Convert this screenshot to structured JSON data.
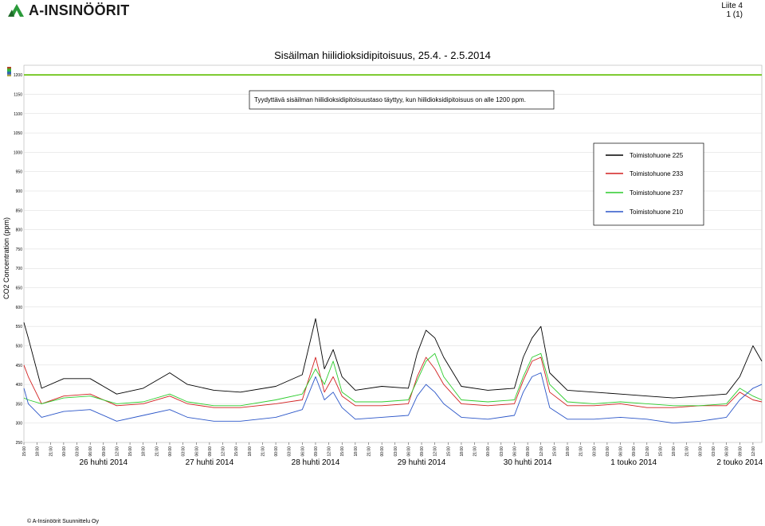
{
  "header": {
    "logo_text": "A-INSINÖÖRIT",
    "page_label": "Liite 4",
    "page_count": "1 (1)"
  },
  "footer": {
    "copyright": "© A-Insinöörit Suunnittelu Oy"
  },
  "colors": {
    "s225": "#000000",
    "s233": "#d22020",
    "s237": "#2ccc2c",
    "s210": "#2a55c8",
    "limit": "#78c828"
  },
  "chart_data": {
    "type": "line",
    "title": "Sisäilman hiilidioksidipitoisuus, 25.4. - 2.5.2014",
    "ylabel": "CO2 Concentration (ppm)",
    "xlabel": "",
    "ylim": [
      250,
      1225
    ],
    "yticks": [
      250,
      300,
      350,
      400,
      450,
      500,
      550,
      600,
      650,
      700,
      750,
      800,
      850,
      900,
      950,
      1000,
      1050,
      1100,
      1150,
      1200
    ],
    "grid": true,
    "legend_position": "right",
    "limit_line": 1200,
    "annotation": "Tyydyttävä sisäilman hiilidioksidipitoisuustaso täyttyy, kun hiilidioksidipitoisuus on alle 1200 ppm.",
    "x_start": "2014-04-25 15:00",
    "x_end": "2014-05-02 14:00",
    "hour_labels": [
      "15:00",
      "18:00",
      "21:00",
      "00:00",
      "03:00",
      "06:00",
      "09:00",
      "12:00"
    ],
    "day_labels": [
      "26 huhti 2014",
      "27 huhti 2014",
      "28 huhti 2014",
      "29 huhti 2014",
      "30 huhti 2014",
      "1 touko 2014",
      "2 touko 2014"
    ],
    "series": [
      {
        "name": "Toimistohuone 225",
        "color": "#000000",
        "x": [
          "2014-04-25 15:00",
          "2014-04-25 16:00",
          "2014-04-25 19:00",
          "2014-04-26 00:00",
          "2014-04-26 06:00",
          "2014-04-26 12:00",
          "2014-04-26 18:00",
          "2014-04-27 00:00",
          "2014-04-27 04:00",
          "2014-04-27 10:00",
          "2014-04-27 16:00",
          "2014-04-28 00:00",
          "2014-04-28 06:00",
          "2014-04-28 09:00",
          "2014-04-28 11:00",
          "2014-04-28 13:00",
          "2014-04-28 15:00",
          "2014-04-28 18:00",
          "2014-04-29 00:00",
          "2014-04-29 06:00",
          "2014-04-29 08:00",
          "2014-04-29 10:00",
          "2014-04-29 12:00",
          "2014-04-29 14:00",
          "2014-04-29 18:00",
          "2014-04-30 00:00",
          "2014-04-30 06:00",
          "2014-04-30 08:00",
          "2014-04-30 10:00",
          "2014-04-30 12:00",
          "2014-04-30 14:00",
          "2014-04-30 18:00",
          "2014-05-01 00:00",
          "2014-05-01 06:00",
          "2014-05-01 12:00",
          "2014-05-01 18:00",
          "2014-05-02 00:00",
          "2014-05-02 06:00",
          "2014-05-02 09:00",
          "2014-05-02 12:00",
          "2014-05-02 14:00"
        ],
        "values": [
          560,
          520,
          390,
          415,
          415,
          375,
          390,
          430,
          400,
          385,
          380,
          395,
          425,
          570,
          440,
          490,
          420,
          385,
          395,
          390,
          480,
          540,
          520,
          470,
          395,
          385,
          390,
          470,
          520,
          550,
          430,
          385,
          380,
          375,
          370,
          365,
          370,
          375,
          420,
          500,
          460
        ]
      },
      {
        "name": "Toimistohuone 233",
        "color": "#d22020",
        "x": [
          "2014-04-25 15:00",
          "2014-04-25 16:00",
          "2014-04-25 19:00",
          "2014-04-26 00:00",
          "2014-04-26 06:00",
          "2014-04-26 12:00",
          "2014-04-26 18:00",
          "2014-04-27 00:00",
          "2014-04-27 04:00",
          "2014-04-27 10:00",
          "2014-04-27 16:00",
          "2014-04-28 00:00",
          "2014-04-28 06:00",
          "2014-04-28 09:00",
          "2014-04-28 11:00",
          "2014-04-28 13:00",
          "2014-04-28 15:00",
          "2014-04-28 18:00",
          "2014-04-29 00:00",
          "2014-04-29 06:00",
          "2014-04-29 08:00",
          "2014-04-29 10:00",
          "2014-04-29 12:00",
          "2014-04-29 14:00",
          "2014-04-29 18:00",
          "2014-04-30 00:00",
          "2014-04-30 06:00",
          "2014-04-30 08:00",
          "2014-04-30 10:00",
          "2014-04-30 12:00",
          "2014-04-30 14:00",
          "2014-04-30 18:00",
          "2014-05-01 00:00",
          "2014-05-01 06:00",
          "2014-05-01 12:00",
          "2014-05-01 18:00",
          "2014-05-02 00:00",
          "2014-05-02 06:00",
          "2014-05-02 09:00",
          "2014-05-02 12:00",
          "2014-05-02 14:00"
        ],
        "values": [
          450,
          420,
          350,
          370,
          375,
          345,
          350,
          370,
          350,
          340,
          340,
          350,
          360,
          470,
          380,
          420,
          370,
          345,
          345,
          350,
          420,
          470,
          440,
          400,
          350,
          345,
          350,
          410,
          460,
          470,
          380,
          345,
          345,
          350,
          340,
          340,
          345,
          345,
          380,
          360,
          355
        ]
      },
      {
        "name": "Toimistohuone 237",
        "color": "#2ccc2c",
        "x": [
          "2014-04-25 15:00",
          "2014-04-25 16:00",
          "2014-04-25 19:00",
          "2014-04-26 00:00",
          "2014-04-26 06:00",
          "2014-04-26 12:00",
          "2014-04-26 18:00",
          "2014-04-27 00:00",
          "2014-04-27 04:00",
          "2014-04-27 10:00",
          "2014-04-27 16:00",
          "2014-04-28 00:00",
          "2014-04-28 06:00",
          "2014-04-28 09:00",
          "2014-04-28 11:00",
          "2014-04-28 13:00",
          "2014-04-28 15:00",
          "2014-04-28 18:00",
          "2014-04-29 00:00",
          "2014-04-29 06:00",
          "2014-04-29 08:00",
          "2014-04-29 10:00",
          "2014-04-29 12:00",
          "2014-04-29 14:00",
          "2014-04-29 18:00",
          "2014-04-30 00:00",
          "2014-04-30 06:00",
          "2014-04-30 08:00",
          "2014-04-30 10:00",
          "2014-04-30 12:00",
          "2014-04-30 14:00",
          "2014-04-30 18:00",
          "2014-05-01 00:00",
          "2014-05-01 06:00",
          "2014-05-01 12:00",
          "2014-05-01 18:00",
          "2014-05-02 00:00",
          "2014-05-02 06:00",
          "2014-05-02 09:00",
          "2014-05-02 12:00",
          "2014-05-02 14:00"
        ],
        "values": [
          365,
          360,
          350,
          365,
          370,
          350,
          355,
          375,
          355,
          345,
          345,
          360,
          375,
          440,
          400,
          460,
          380,
          355,
          355,
          360,
          410,
          460,
          480,
          420,
          360,
          355,
          360,
          420,
          470,
          480,
          400,
          355,
          350,
          355,
          350,
          345,
          345,
          350,
          390,
          370,
          360
        ]
      },
      {
        "name": "Toimistohuone 210",
        "color": "#2a55c8",
        "x": [
          "2014-04-25 15:00",
          "2014-04-25 16:00",
          "2014-04-25 19:00",
          "2014-04-26 00:00",
          "2014-04-26 06:00",
          "2014-04-26 12:00",
          "2014-04-26 18:00",
          "2014-04-27 00:00",
          "2014-04-27 04:00",
          "2014-04-27 10:00",
          "2014-04-27 16:00",
          "2014-04-28 00:00",
          "2014-04-28 06:00",
          "2014-04-28 09:00",
          "2014-04-28 11:00",
          "2014-04-28 13:00",
          "2014-04-28 15:00",
          "2014-04-28 18:00",
          "2014-04-29 00:00",
          "2014-04-29 06:00",
          "2014-04-29 08:00",
          "2014-04-29 10:00",
          "2014-04-29 12:00",
          "2014-04-29 14:00",
          "2014-04-29 18:00",
          "2014-04-30 00:00",
          "2014-04-30 06:00",
          "2014-04-30 08:00",
          "2014-04-30 10:00",
          "2014-04-30 12:00",
          "2014-04-30 14:00",
          "2014-04-30 18:00",
          "2014-05-01 00:00",
          "2014-05-01 06:00",
          "2014-05-01 12:00",
          "2014-05-01 18:00",
          "2014-05-02 00:00",
          "2014-05-02 06:00",
          "2014-05-02 09:00",
          "2014-05-02 12:00",
          "2014-05-02 14:00"
        ],
        "values": [
          390,
          350,
          315,
          330,
          335,
          305,
          320,
          335,
          315,
          305,
          305,
          315,
          335,
          420,
          360,
          380,
          340,
          310,
          315,
          320,
          370,
          400,
          380,
          350,
          315,
          310,
          320,
          380,
          420,
          430,
          340,
          310,
          310,
          315,
          310,
          300,
          305,
          315,
          360,
          390,
          400
        ]
      }
    ]
  }
}
